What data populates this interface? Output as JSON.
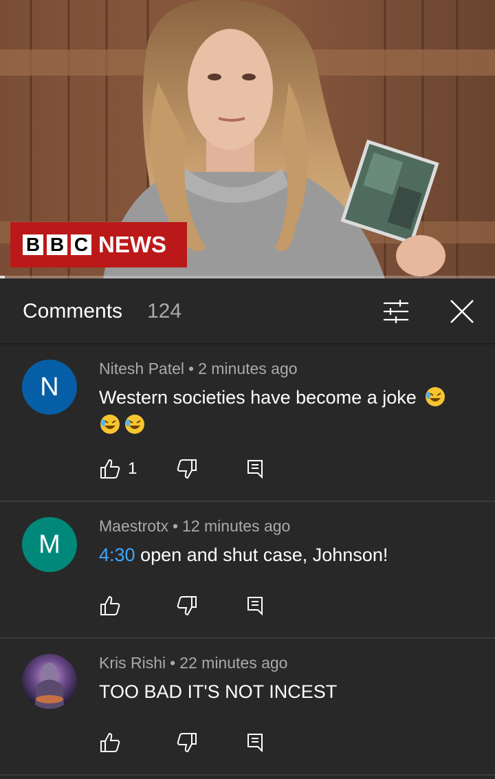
{
  "video": {
    "channel_badge_blocks": [
      "B",
      "B",
      "C"
    ],
    "channel_badge_word": "NEWS",
    "progress_fraction": 0.01,
    "badge_color": "#bb1919"
  },
  "comments_header": {
    "title": "Comments",
    "count": "124",
    "filter_icon": "sort-filter-icon",
    "close_icon": "close-icon"
  },
  "comments": [
    {
      "avatar_letter": "N",
      "avatar_color": "#065fa6",
      "author": "Nitesh Patel",
      "time": "2 minutes ago",
      "text_parts": [
        "Western societies have become a joke"
      ],
      "emoji": "rolling-on-floor-laughing",
      "like_count": "1"
    },
    {
      "avatar_letter": "M",
      "avatar_color": "#00897b",
      "author": "Maestrotx",
      "time": "12 minutes ago",
      "timestamp_link": "4:30",
      "text": " open and shut case, Johnson!",
      "like_count": ""
    },
    {
      "avatar_letter": "",
      "avatar_image": "fantasy-warrior-avatar",
      "author": "Kris Rishi",
      "time": "22 minutes ago",
      "text": "TOO BAD IT'S NOT INCEST",
      "like_count": ""
    }
  ],
  "separator": "•"
}
